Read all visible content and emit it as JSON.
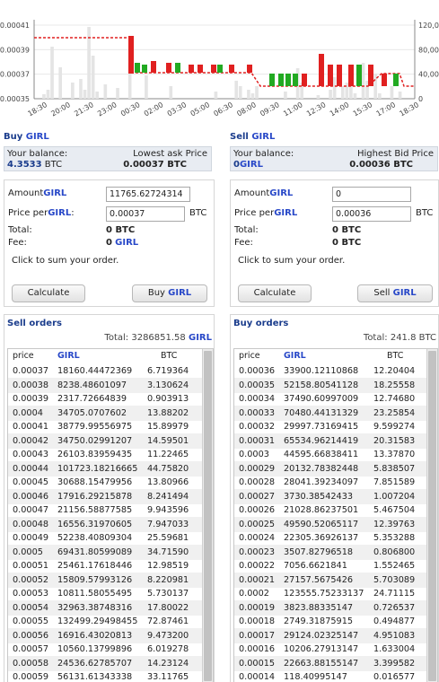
{
  "chart": {
    "y_left_labels": [
      "0.00041",
      "0.00039",
      "0.00037",
      "0.00035"
    ],
    "y_right_labels": [
      "120,00",
      "80,000",
      "40,000",
      "0"
    ],
    "x_labels": [
      "18:30",
      "20:00",
      "21:30",
      "23:00",
      "00:30",
      "02:00",
      "03:30",
      "05:00",
      "06:30",
      "08:00",
      "09:30",
      "11:00",
      "12:30",
      "14:00",
      "15:30",
      "17:00",
      "18:30"
    ],
    "colors": {
      "up": "#22aa22",
      "down": "#e02020",
      "avg_line": "#e02020",
      "volume": "#e4e4e4",
      "grid": "#e8e8e8"
    }
  },
  "sell_panel": {
    "title_prefix": "Buy",
    "coin": "GIRL",
    "your_balance_label": "Your balance:",
    "your_balance_value": "4.3533",
    "your_balance_unit": "BTC",
    "price_label": "Lowest ask Price",
    "price_value": "0.00037 BTC",
    "amount_label": "Amount",
    "amount_value": "11765.62724314",
    "price_per_label": "Price per",
    "price_per_value": "0.00037",
    "price_per_unit": "BTC",
    "total_label": "Total:",
    "total_value": "0 BTC",
    "fee_label": "Fee:",
    "fee_value": "0",
    "hint": "Click to sum your order.",
    "calc_button": "Calculate",
    "action_button": "Buy"
  },
  "buy_panel": {
    "title_prefix": "Sell",
    "coin": "GIRL",
    "your_balance_label": "Your balance:",
    "your_balance_value": "0",
    "your_balance_unit": "GIRL",
    "price_label": "Highest Bid Price",
    "price_value": "0.00036 BTC",
    "amount_label": "Amount",
    "amount_value": "0",
    "price_per_label": "Price per",
    "price_per_value": "0.00036",
    "price_per_unit": "BTC",
    "total_label": "Total:",
    "total_value": "0 BTC",
    "fee_label": "Fee:",
    "fee_value": "0 BTC",
    "hint": "Click to sum your order.",
    "calc_button": "Calculate",
    "action_button": "Sell"
  },
  "sell_orders": {
    "title": "Sell orders",
    "total_label": "Total:",
    "total_value": "3286851.58",
    "total_unit": "GIRL",
    "columns": [
      "price",
      "GIRL",
      "BTC"
    ],
    "rows": [
      [
        "0.00037",
        "18160.44472369",
        "6.719364"
      ],
      [
        "0.00038",
        "8238.48601097",
        "3.130624"
      ],
      [
        "0.00039",
        "2317.72664839",
        "0.903913"
      ],
      [
        "0.0004",
        "34705.0707602",
        "13.88202"
      ],
      [
        "0.00041",
        "38779.99556975",
        "15.89979"
      ],
      [
        "0.00042",
        "34750.02991207",
        "14.59501"
      ],
      [
        "0.00043",
        "26103.83959435",
        "11.22465"
      ],
      [
        "0.00044",
        "101723.18216665",
        "44.75820"
      ],
      [
        "0.00045",
        "30688.15479956",
        "13.80966"
      ],
      [
        "0.00046",
        "17916.29215878",
        "8.241494"
      ],
      [
        "0.00047",
        "21156.58877585",
        "9.943596"
      ],
      [
        "0.00048",
        "16556.31970605",
        "7.947033"
      ],
      [
        "0.00049",
        "52238.40809304",
        "25.59681"
      ],
      [
        "0.0005",
        "69431.80599089",
        "34.71590"
      ],
      [
        "0.00051",
        "25461.17618446",
        "12.98519"
      ],
      [
        "0.00052",
        "15809.57993126",
        "8.220981"
      ],
      [
        "0.00053",
        "10811.58055495",
        "5.730137"
      ],
      [
        "0.00054",
        "32963.38748316",
        "17.80022"
      ],
      [
        "0.00055",
        "132499.29498455",
        "72.87461"
      ],
      [
        "0.00056",
        "16916.43020813",
        "9.473200"
      ],
      [
        "0.00057",
        "10560.13799896",
        "6.019278"
      ],
      [
        "0.00058",
        "24536.62785707",
        "14.23124"
      ],
      [
        "0.00059",
        "56131.61343338",
        "33.11765"
      ]
    ]
  },
  "buy_orders": {
    "title": "Buy orders",
    "total_label": "Total:",
    "total_value": "241.8 BTC",
    "columns": [
      "price",
      "GIRL",
      "BTC"
    ],
    "rows": [
      [
        "0.00036",
        "33900.12110868",
        "12.20404"
      ],
      [
        "0.00035",
        "52158.80541128",
        "18.25558"
      ],
      [
        "0.00034",
        "37490.60997009",
        "12.74680"
      ],
      [
        "0.00033",
        "70480.44131329",
        "23.25854"
      ],
      [
        "0.00032",
        "29997.73169415",
        "9.599274"
      ],
      [
        "0.00031",
        "65534.96214419",
        "20.31583"
      ],
      [
        "0.0003",
        "44595.66838411",
        "13.37870"
      ],
      [
        "0.00029",
        "20132.78382448",
        "5.838507"
      ],
      [
        "0.00028",
        "28041.39234097",
        "7.851589"
      ],
      [
        "0.00027",
        "3730.38542433",
        "1.007204"
      ],
      [
        "0.00026",
        "21028.86237501",
        "5.467504"
      ],
      [
        "0.00025",
        "49590.52065117",
        "12.39763"
      ],
      [
        "0.00024",
        "22305.36926137",
        "5.353288"
      ],
      [
        "0.00023",
        "3507.82796518",
        "0.806800"
      ],
      [
        "0.00022",
        "7056.6621841",
        "1.552465"
      ],
      [
        "0.00021",
        "27157.5675426",
        "5.703089"
      ],
      [
        "0.0002",
        "123555.75233137",
        "24.71115"
      ],
      [
        "0.00019",
        "3823.88335147",
        "0.726537"
      ],
      [
        "0.00018",
        "2749.31875915",
        "0.494877"
      ],
      [
        "0.00017",
        "29124.02325147",
        "4.951083"
      ],
      [
        "0.00016",
        "10206.27913147",
        "1.633004"
      ],
      [
        "0.00015",
        "22663.88155147",
        "3.399582"
      ],
      [
        "0.00014",
        "118.40995147",
        "0.016577"
      ]
    ]
  }
}
